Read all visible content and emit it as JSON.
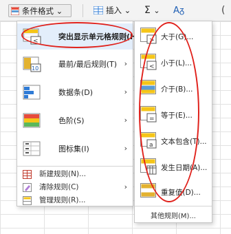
{
  "ribbon": {
    "conditional_format": "条件格式",
    "conditional_format_caret": "⌄",
    "insert": "插入",
    "insert_caret": "⌄",
    "sum_symbol": "Σ",
    "sum_caret": "⌄",
    "sort_symbol": "Aᵹ",
    "paren": "("
  },
  "menu": {
    "items": [
      {
        "label": "突出显示单元格规则(H)",
        "icon": "highlight-cells-rules-icon",
        "has_submenu": true
      },
      {
        "label": "最前/最后规则(T)",
        "icon": "top-bottom-rules-icon",
        "has_submenu": true
      },
      {
        "label": "数据条(D)",
        "icon": "data-bars-icon",
        "has_submenu": true
      },
      {
        "label": "色阶(S)",
        "icon": "color-scales-icon",
        "has_submenu": true
      },
      {
        "label": "图标集(I)",
        "icon": "icon-sets-icon",
        "has_submenu": true
      }
    ],
    "small_items": [
      {
        "label": "新建规则(N)...",
        "icon": "new-rule-icon"
      },
      {
        "label": "清除规则(C)",
        "icon": "clear-rules-icon",
        "has_submenu": true
      },
      {
        "label": "管理规则(R)...",
        "icon": "manage-rules-icon"
      }
    ],
    "arrow": "›"
  },
  "submenu": {
    "items": [
      {
        "label": "大于(G)...",
        "icon": "greater-than-icon"
      },
      {
        "label": "小于(L)...",
        "icon": "less-than-icon"
      },
      {
        "label": "介于(B)...",
        "icon": "between-icon"
      },
      {
        "label": "等于(E)...",
        "icon": "equal-to-icon"
      },
      {
        "label": "文本包含(T)...",
        "icon": "text-contains-icon"
      },
      {
        "label": "发生日期(A)...",
        "icon": "date-occurring-icon"
      },
      {
        "label": "重复值(D)...",
        "icon": "duplicate-values-icon"
      }
    ],
    "more": "其他规则(M)..."
  },
  "colors": {
    "highlight": "#e3eefb",
    "annotation_red": "#e0211b",
    "accent_blue": "#1f5fb4"
  }
}
